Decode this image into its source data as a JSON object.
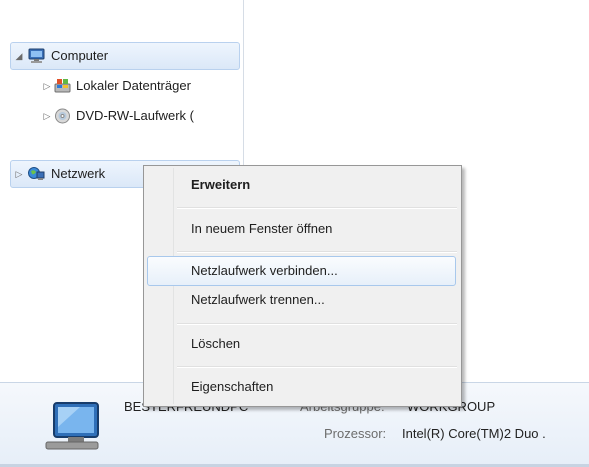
{
  "nav": {
    "items": [
      {
        "label": "Computer",
        "icon": "computer-icon",
        "expanded": true
      },
      {
        "label": "Lokaler Datenträger",
        "icon": "local-disk-icon",
        "expanded": false
      },
      {
        "label": "DVD-RW-Laufwerk (",
        "icon": "dvd-drive-icon",
        "expanded": false
      },
      {
        "label": "Netzwerk",
        "icon": "network-icon",
        "expanded": false
      }
    ]
  },
  "context_menu": {
    "items": [
      {
        "label": "Erweitern",
        "default": true
      },
      {
        "label": "In neuem Fenster öffnen"
      },
      {
        "label": "Netzlaufwerk verbinden...",
        "highlighted": true
      },
      {
        "label": "Netzlaufwerk trennen..."
      },
      {
        "label": "Löschen"
      },
      {
        "label": "Eigenschaften"
      }
    ]
  },
  "details": {
    "computer_name": "BESTERFREUNDPC",
    "workgroup_label": "Arbeitsgruppe:",
    "workgroup_value": "WORKGROUP",
    "processor_label": "Prozessor:",
    "processor_value": "Intel(R) Core(TM)2 Duo ."
  },
  "colors": {
    "selection": "#dbe8f8",
    "menu_highlight_border": "#a8c8ec",
    "menu_background": "#f0f0f0"
  }
}
